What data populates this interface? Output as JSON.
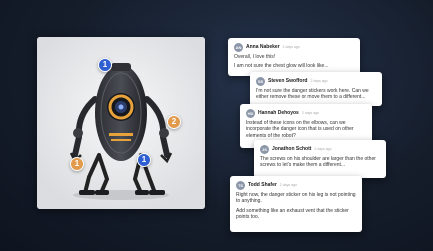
{
  "pins": [
    {
      "label": "1",
      "color": "#2f5fd0"
    },
    {
      "label": "2",
      "color": "#e29a4c"
    },
    {
      "label": "1",
      "color": "#e29a4c"
    },
    {
      "label": "1",
      "color": "#2f5fd0"
    },
    {
      "label": "2",
      "color": "#e29a4c"
    }
  ],
  "comments": [
    {
      "initials": "AN",
      "author": "Anna Nabeker",
      "time": "2 days ago",
      "body": [
        "Overall, I love this!",
        "I am not sure the chest glow will look like..."
      ]
    },
    {
      "initials": "SS",
      "author": "Steven Swofford",
      "time": "2 days ago",
      "body": [
        "I'm not sure the danger stickers work here. Can we either remove these or move them to a different..."
      ]
    },
    {
      "initials": "HD",
      "author": "Hannah Dehoyos",
      "time": "2 days ago",
      "body": [
        "Instead of these icons on the elbows, can we incorporate the danger icon that is used on other elements of the robot?"
      ]
    },
    {
      "initials": "JS",
      "author": "Jonathon Schott",
      "time": "2 days ago",
      "body": [
        "The screws on his shoulder are larger than the other screws to let's make them a different..."
      ]
    },
    {
      "initials": "TS",
      "author": "Todd Shafer",
      "time": "2 days ago",
      "body": [
        "Right now, the danger sticker on his leg is not pointing to anything.",
        "Add something like an exhaust vent that the sticker points too."
      ]
    }
  ]
}
